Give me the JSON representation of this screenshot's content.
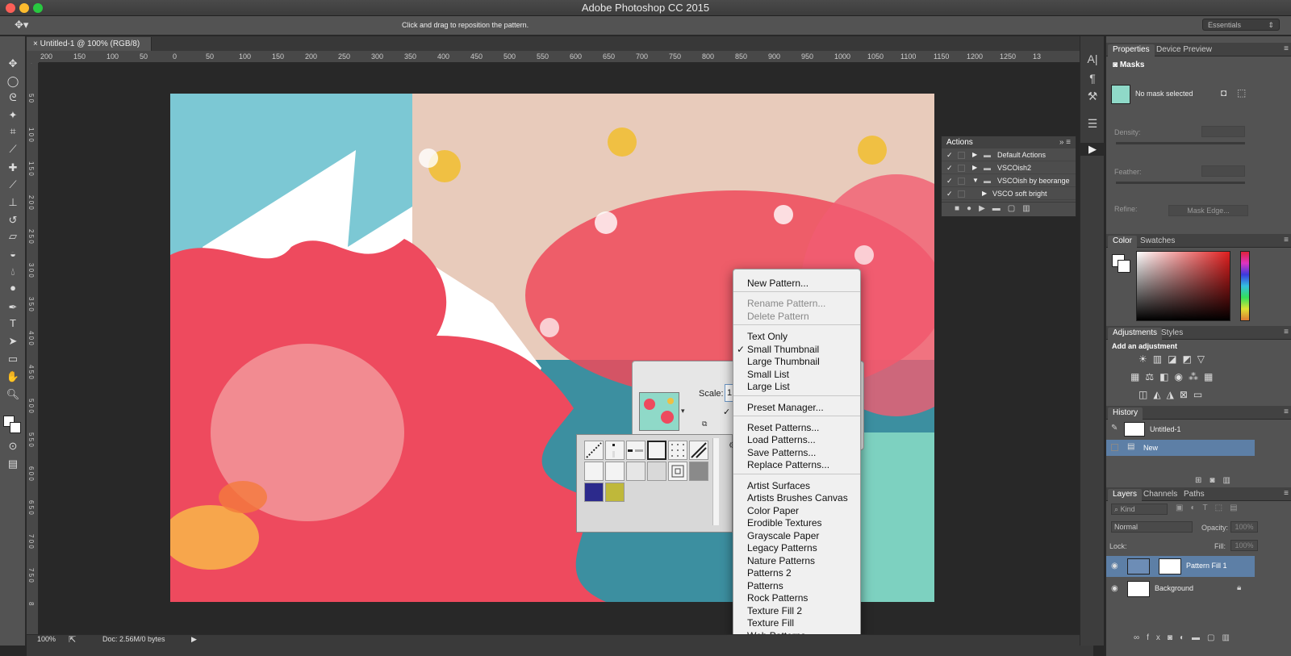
{
  "app": {
    "title": "Adobe Photoshop CC 2015",
    "options_hint": "Click and drag to reposition the pattern.",
    "workspace": "Essentials"
  },
  "document": {
    "tab_title": "Untitled-1 @ 100% (RGB/8)",
    "zoom": "100%",
    "doc_size": "Doc: 2.56M/0 bytes"
  },
  "ruler": {
    "h_ticks": [
      "200",
      "150",
      "100",
      "50",
      "0",
      "50",
      "100",
      "150",
      "200",
      "250",
      "300",
      "350",
      "400",
      "450",
      "500",
      "550",
      "600",
      "650",
      "700",
      "750",
      "800",
      "850",
      "900",
      "950",
      "1000",
      "1050",
      "1100",
      "1150",
      "1200",
      "1250",
      "13"
    ],
    "v_ticks": [
      "0",
      "5 0",
      "1 0 0",
      "1 5 0",
      "2 0 0",
      "2 5 0",
      "3 0 0",
      "3 5 0",
      "4 0 0",
      "4 5 0",
      "5 0 0",
      "5 5 0",
      "6 0 0",
      "6 5 0",
      "7 0 0",
      "7 5 0",
      "8"
    ]
  },
  "actions_panel": {
    "title": "Actions",
    "items": [
      {
        "label": "Default Actions",
        "expanded": false
      },
      {
        "label": "VSCOish2",
        "expanded": false
      },
      {
        "label": "VSCOish by beorange",
        "expanded": true
      },
      {
        "label": "VSCO soft bright",
        "expanded": false
      }
    ]
  },
  "pattern_dialog": {
    "scale_label": "Scale:",
    "scale_value": "1"
  },
  "context_menu": {
    "items": [
      {
        "label": "New Pattern...",
        "disabled": false
      },
      {
        "label": "Rename Pattern...",
        "disabled": true
      },
      {
        "label": "Delete Pattern",
        "disabled": true
      },
      {
        "label": "Text Only",
        "disabled": false
      },
      {
        "label": "Small Thumbnail",
        "disabled": false,
        "checked": true
      },
      {
        "label": "Large Thumbnail",
        "disabled": false
      },
      {
        "label": "Small List",
        "disabled": false
      },
      {
        "label": "Large List",
        "disabled": false
      },
      {
        "label": "Preset Manager...",
        "disabled": false
      },
      {
        "label": "Reset Patterns...",
        "disabled": false
      },
      {
        "label": "Load Patterns...",
        "disabled": false
      },
      {
        "label": "Save Patterns...",
        "disabled": false
      },
      {
        "label": "Replace Patterns...",
        "disabled": false
      },
      {
        "label": "Artist Surfaces",
        "disabled": false
      },
      {
        "label": "Artists Brushes Canvas",
        "disabled": false
      },
      {
        "label": "Color Paper",
        "disabled": false
      },
      {
        "label": "Erodible Textures",
        "disabled": false
      },
      {
        "label": "Grayscale Paper",
        "disabled": false
      },
      {
        "label": "Legacy Patterns",
        "disabled": false
      },
      {
        "label": "Nature Patterns",
        "disabled": false
      },
      {
        "label": "Patterns 2",
        "disabled": false
      },
      {
        "label": "Patterns",
        "disabled": false
      },
      {
        "label": "Rock Patterns",
        "disabled": false
      },
      {
        "label": "Texture Fill 2",
        "disabled": false
      },
      {
        "label": "Texture Fill",
        "disabled": false
      },
      {
        "label": "Web Patterns",
        "disabled": false
      }
    ]
  },
  "properties_panel": {
    "tabs": [
      "Properties",
      "Device Preview"
    ],
    "section": "Masks",
    "no_mask": "No mask selected",
    "density_label": "Density:",
    "feather_label": "Feather:",
    "refine_label": "Refine:",
    "mask_edge_button": "Mask Edge..."
  },
  "color_panel": {
    "tabs": [
      "Color",
      "Swatches"
    ]
  },
  "adjustments_panel": {
    "tabs": [
      "Adjustments",
      "Styles"
    ],
    "heading": "Add an adjustment"
  },
  "history_panel": {
    "tab": "History",
    "snapshot": "Untitled-1",
    "items": [
      "New"
    ]
  },
  "layers_panel": {
    "tabs": [
      "Layers",
      "Channels",
      "Paths"
    ],
    "filter": "Kind",
    "blend_mode": "Normal",
    "opacity_label": "Opacity:",
    "opacity_value": "100%",
    "lock_label": "Lock:",
    "fill_label": "Fill:",
    "fill_value": "100%",
    "layers": [
      {
        "name": "Pattern Fill 1",
        "selected": true
      },
      {
        "name": "Background",
        "locked": true
      }
    ]
  },
  "colors": {
    "accent_selected": "#5d7fa6",
    "panel_bg": "#535353"
  }
}
